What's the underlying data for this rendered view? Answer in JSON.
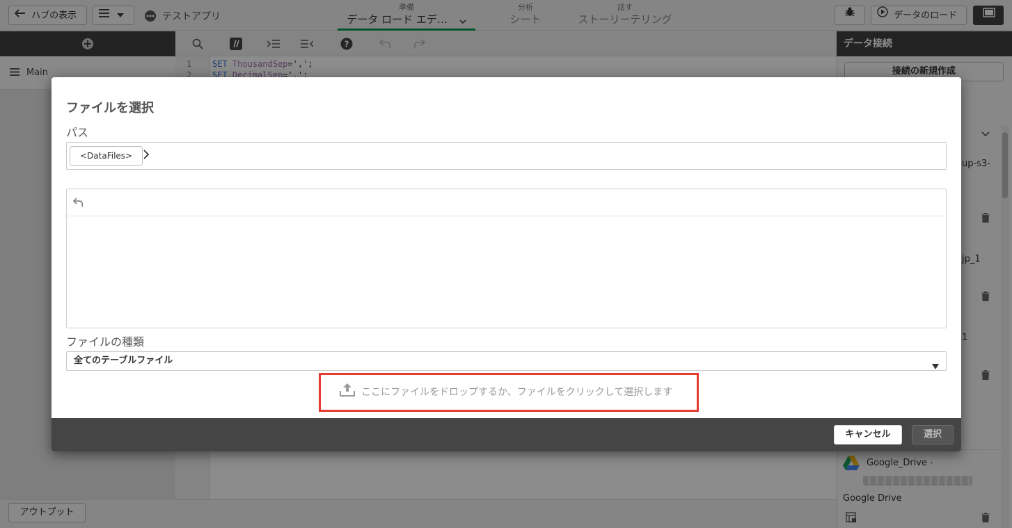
{
  "topbar": {
    "back_hub_label": "ハブの表示",
    "app_name": "テストアプリ",
    "tabs": [
      {
        "sub": "準備",
        "main": "データ ロード エデ…"
      },
      {
        "sub": "分析",
        "main": "シート"
      },
      {
        "sub": "話す",
        "main": "ストーリーテリング"
      }
    ],
    "load_data_label": "データのロード"
  },
  "left_panel": {
    "section_label": "Main"
  },
  "editor": {
    "lines": [
      {
        "num": "1",
        "keyword": "SET",
        "var": "ThousandSep",
        "rest": "=',';"
      },
      {
        "num": "2",
        "keyword": "SET",
        "var": "DecimalSep",
        "rest": "='.';"
      }
    ]
  },
  "right_panel": {
    "header": "データ接続",
    "new_connection_label": "接続の新規作成",
    "fragments": [
      "up-s3-",
      "jp_1",
      "1"
    ],
    "google_drive": {
      "name": "Google_Drive -",
      "type": "Google Drive"
    }
  },
  "bottombar": {
    "output_label": "アウトプット"
  },
  "dialog": {
    "title": "ファイルを選択",
    "path_label": "パス",
    "path_crumb": "<DataFiles>",
    "file_type_label": "ファイルの種類",
    "file_type_value": "全てのテーブルファイル",
    "drop_text": "ここにファイルをドロップするか、ファイルをクリックして選択します",
    "cancel_label": "キャンセル",
    "select_label": "選択"
  },
  "colors": {
    "active_tab": "#009845",
    "highlight_border": "#e53b30",
    "footer_bg": "#454545"
  }
}
